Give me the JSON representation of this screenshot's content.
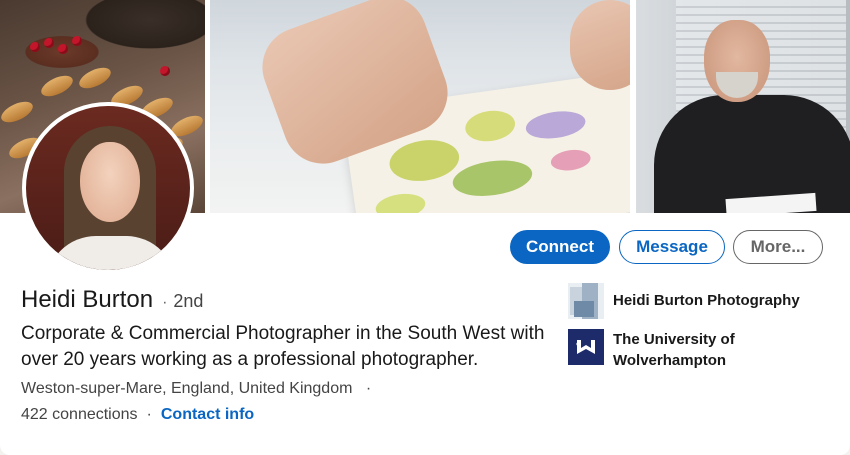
{
  "profile": {
    "name": "Heidi Burton",
    "connection_degree": "2nd",
    "separator": "·",
    "headline": "Corporate & Commercial Photographer in the South West with over 20 years working as a professional photographer.",
    "location": "Weston-super-Mare, England, United Kingdom",
    "connections": "422 connections",
    "contact_info": "Contact info"
  },
  "actions": {
    "connect": "Connect",
    "message": "Message",
    "more": "More..."
  },
  "organizations": [
    {
      "name": "Heidi Burton Photography",
      "icon": "company-logo"
    },
    {
      "name": "The University of Wolverhampton",
      "icon": "university-logo"
    }
  ],
  "colors": {
    "primary": "#0a66c2",
    "secondary_text": "#666666",
    "university_brand": "#1d2b6b"
  }
}
